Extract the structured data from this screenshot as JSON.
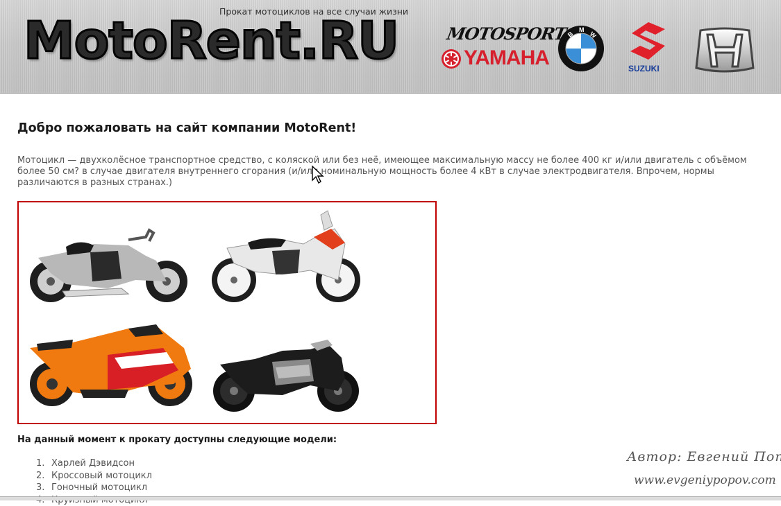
{
  "header": {
    "tagline": "Прокат мотоциклов на все случаи жизни",
    "logo_text": "MotoRent.RU",
    "brands": [
      {
        "name": "Motosport Yamaha",
        "motosport_text": "MOTOSPORT",
        "word": "YAMAHA",
        "icon": "yamaha-logo"
      },
      {
        "name": "BMW",
        "letters": [
          "B",
          "M",
          "W"
        ],
        "icon": "bmw-logo"
      },
      {
        "name": "Suzuki",
        "word": "SUZUKI",
        "icon": "suzuki-logo"
      },
      {
        "name": "Honda",
        "icon": "honda-logo"
      }
    ]
  },
  "main": {
    "welcome_heading": "Добро пожаловать на сайт компании MotoRent!",
    "intro_text": "Мотоцикл — двухколёсное транспортное средство, с коляской или без неё, имеющее максимальную массу не более 400 кг и/или двигатель с объёмом более 50 см? в случае двигателя внутреннего сгорания (и/или номинальную мощность более 4 кВт в случае электродвигателя. Впрочем, нормы различаются в разных странах.)",
    "gallery": [
      {
        "icon": "cruiser-motorcycle-image",
        "color": "#b8b8b8"
      },
      {
        "icon": "enduro-motorcycle-image",
        "color": "#e8e8e8"
      },
      {
        "icon": "sport-motorcycle-image",
        "color": "#f07a10"
      },
      {
        "icon": "streetfighter-motorcycle-image",
        "color": "#1c1c1c"
      }
    ],
    "models_heading": "На данный момент к прокату доступны следующие модели:",
    "models": [
      {
        "num": "1.",
        "label": "Харлей Дэвидсон"
      },
      {
        "num": "2.",
        "label": "Кроссовый мотоцикл"
      },
      {
        "num": "3.",
        "label": "Гоночный мотоцикл"
      },
      {
        "num": "4.",
        "label": "Круизный мотоцикл"
      }
    ]
  },
  "signature": {
    "author": "Автор: Евгений Попов",
    "site": "www.evgeniypopov.com"
  },
  "colors": {
    "gallery_border": "#c00000",
    "yamaha_red": "#d6202d",
    "suzuki_red": "#e0202a",
    "suzuki_blue": "#1a3f9a",
    "bmw_blue": "#3a8fd6",
    "text_gray": "#555555"
  }
}
